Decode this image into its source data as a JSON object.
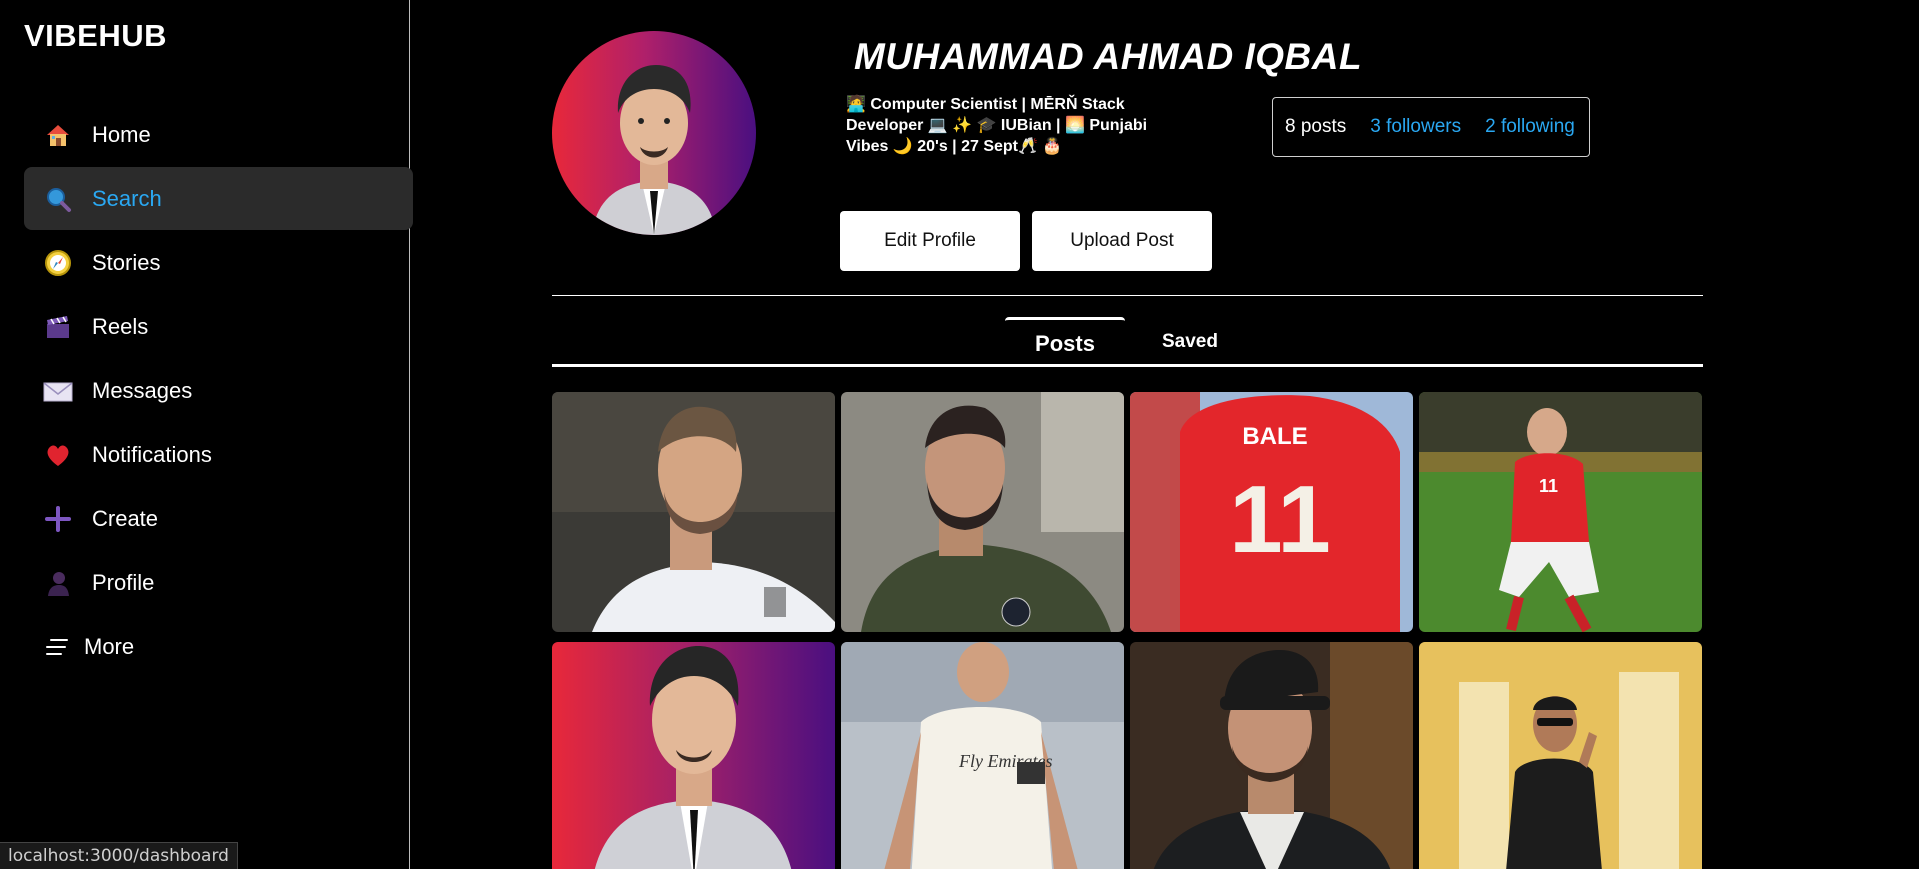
{
  "app": {
    "logo": "VIBEHUB"
  },
  "sidebar": {
    "items": [
      {
        "label": "Home",
        "icon": "house-icon"
      },
      {
        "label": "Search",
        "icon": "magnifier-icon",
        "active": true
      },
      {
        "label": "Stories",
        "icon": "compass-icon"
      },
      {
        "label": "Reels",
        "icon": "clapper-icon"
      },
      {
        "label": "Messages",
        "icon": "envelope-icon"
      },
      {
        "label": "Notifications",
        "icon": "heart-icon"
      },
      {
        "label": "Create",
        "icon": "plus-icon"
      },
      {
        "label": "Profile",
        "icon": "person-icon"
      }
    ],
    "more": {
      "label": "More",
      "icon": "hamburger-icon"
    }
  },
  "profile": {
    "name": "MUHAMMAD AHMAD IQBAL",
    "bio": "🧑‍💻 Computer Scientist | MĒRŇ Stack Developer 💻 ✨ 🎓 IUBian | 🌅 Punjabi Vibes 🌙 20's | 27 Sept🥂 🎂",
    "stats": {
      "posts": "8 posts",
      "followers": "3 followers",
      "following": "2 following"
    },
    "buttons": {
      "edit": "Edit Profile",
      "upload": "Upload Post"
    }
  },
  "tabs": {
    "posts": "Posts",
    "saved": "Saved",
    "active": "posts"
  },
  "posts": [
    {
      "alt": "player-white-kit",
      "jersey_text": ""
    },
    {
      "alt": "player-green-jacket",
      "jersey_text": ""
    },
    {
      "alt": "player-back-red-jersey",
      "jersey_text": "BALE",
      "jersey_number": "11"
    },
    {
      "alt": "player-red-kit-pitch",
      "jersey_text": "11"
    },
    {
      "alt": "profile-portrait",
      "jersey_text": ""
    },
    {
      "alt": "player-white-realmadrid",
      "jersey_text": "Fly Emirates"
    },
    {
      "alt": "man-black-cap",
      "jersey_text": ""
    },
    {
      "alt": "man-gold-room",
      "jersey_text": ""
    }
  ],
  "status_bar": {
    "url": "localhost:3000/dashboard"
  },
  "colors": {
    "accent": "#2aa8f2",
    "active_bg": "#2b2b2b",
    "background": "#000000"
  }
}
